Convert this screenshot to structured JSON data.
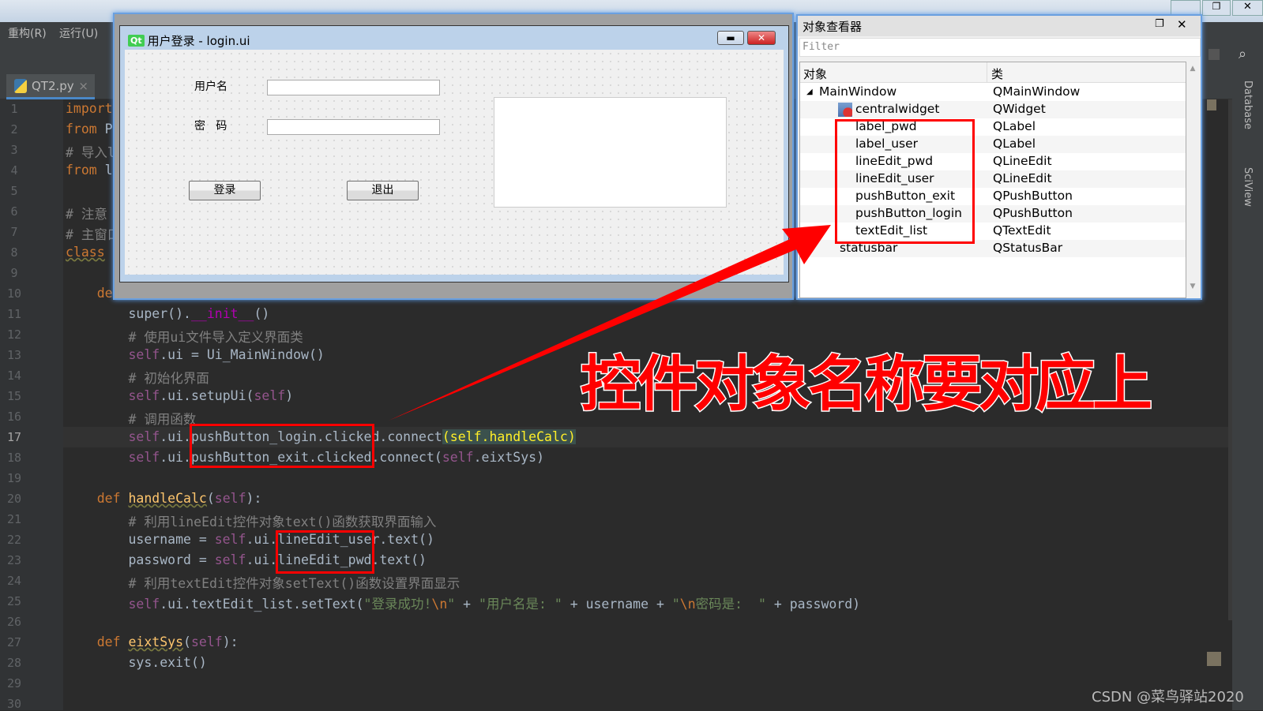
{
  "ide": {
    "menu": [
      "重构(R)",
      "运行(U)"
    ],
    "tab": {
      "label": "QT2.py",
      "close": "×"
    },
    "current_line": 17,
    "lines": [
      {
        "n": 1,
        "t": [
          [
            "import",
            "kw"
          ]
        ]
      },
      {
        "n": 2,
        "t": [
          [
            "from",
            "kw"
          ],
          [
            " P",
            ""
          ]
        ]
      },
      {
        "n": 3,
        "t": [
          [
            "# 导入l",
            "cm"
          ]
        ]
      },
      {
        "n": 4,
        "t": [
          [
            "from",
            "kw"
          ],
          [
            " l",
            ""
          ]
        ]
      },
      {
        "n": 5,
        "t": []
      },
      {
        "n": 6,
        "t": [
          [
            "# 注意",
            "cm"
          ]
        ]
      },
      {
        "n": 7,
        "t": [
          [
            "# 主窗口",
            "cm"
          ]
        ]
      },
      {
        "n": 8,
        "t": [
          [
            "class",
            "kw wavy"
          ]
        ]
      },
      {
        "n": 9,
        "t": []
      },
      {
        "n": 10,
        "t": [
          [
            "    de",
            "kw"
          ]
        ]
      },
      {
        "n": 11,
        "t": [
          [
            "        super().",
            ""
          ],
          [
            "__init__",
            "dun"
          ],
          [
            "()",
            ""
          ]
        ]
      },
      {
        "n": 12,
        "t": [
          [
            "        # 使用ui文件导入定义界面类",
            "cm"
          ]
        ]
      },
      {
        "n": 13,
        "t": [
          [
            "        ",
            ""
          ],
          [
            "self",
            "self"
          ],
          [
            ".ui = Ui_MainWindow()",
            ""
          ]
        ]
      },
      {
        "n": 14,
        "t": [
          [
            "        # 初始化界面",
            "cm"
          ]
        ]
      },
      {
        "n": 15,
        "t": [
          [
            "        ",
            ""
          ],
          [
            "self",
            "self"
          ],
          [
            ".ui.setupUi(",
            ""
          ],
          [
            "self",
            "self"
          ],
          [
            ")",
            ""
          ]
        ]
      },
      {
        "n": 16,
        "t": [
          [
            "        # 调用函数",
            "cm"
          ]
        ]
      },
      {
        "n": 17,
        "t": [
          [
            "        ",
            ""
          ],
          [
            "self",
            "self"
          ],
          [
            ".ui.pushButton_login.clicked.connect",
            ""
          ],
          [
            "(",
            "br"
          ],
          [
            "self",
            "self br"
          ],
          [
            ".handleCalc",
            "br"
          ],
          [
            ")",
            "br"
          ]
        ]
      },
      {
        "n": 18,
        "t": [
          [
            "        ",
            ""
          ],
          [
            "self",
            "self"
          ],
          [
            ".ui.pushButton_exit.clicked.connect(",
            ""
          ],
          [
            "self",
            "self"
          ],
          [
            ".eixtSys)",
            ""
          ]
        ]
      },
      {
        "n": 19,
        "t": []
      },
      {
        "n": 20,
        "t": [
          [
            "    ",
            ""
          ],
          [
            "def",
            "kw"
          ],
          [
            " ",
            ""
          ],
          [
            "handleCalc",
            "fn wavy"
          ],
          [
            "(",
            ""
          ],
          [
            "self",
            "self"
          ],
          [
            "):",
            ""
          ]
        ]
      },
      {
        "n": 21,
        "t": [
          [
            "        # 利用lineEdit控件对象text()函数获取界面输入",
            "cm"
          ]
        ]
      },
      {
        "n": 22,
        "t": [
          [
            "        username = ",
            ""
          ],
          [
            "self",
            "self"
          ],
          [
            ".ui.lineEdit_user.text()",
            ""
          ]
        ]
      },
      {
        "n": 23,
        "t": [
          [
            "        password = ",
            ""
          ],
          [
            "self",
            "self"
          ],
          [
            ".ui.lineEdit_pwd.text()",
            ""
          ]
        ]
      },
      {
        "n": 24,
        "t": [
          [
            "        # 利用textEdit控件对象setText()函数设置界面显示",
            "cm"
          ]
        ]
      },
      {
        "n": 25,
        "t": [
          [
            "        ",
            ""
          ],
          [
            "self",
            "self"
          ],
          [
            ".ui.textEdit_list.setText(",
            ""
          ],
          [
            "\"登录成功!",
            "str"
          ],
          [
            "\\n",
            "esc"
          ],
          [
            "\"",
            "str"
          ],
          [
            " + ",
            ""
          ],
          [
            "\"用户名是: \"",
            "str"
          ],
          [
            " + username + ",
            ""
          ],
          [
            "\"",
            "str"
          ],
          [
            "\\n",
            "esc"
          ],
          [
            "密码是:  \"",
            "str"
          ],
          [
            " + password)",
            ""
          ]
        ]
      },
      {
        "n": 26,
        "t": []
      },
      {
        "n": 27,
        "t": [
          [
            "    ",
            ""
          ],
          [
            "def",
            "kw"
          ],
          [
            " ",
            ""
          ],
          [
            "eixtSys",
            "fn wavy"
          ],
          [
            "(",
            ""
          ],
          [
            "self",
            "self"
          ],
          [
            "):",
            ""
          ]
        ]
      },
      {
        "n": 28,
        "t": [
          [
            "        sys.exit()",
            ""
          ]
        ]
      },
      {
        "n": 29,
        "t": []
      },
      {
        "n": 30,
        "t": []
      }
    ],
    "right_tools": [
      "Database",
      "SciView"
    ]
  },
  "designer": {
    "title": "用户登录 - login.ui",
    "qt_badge": "Qt",
    "min_icon": "▬",
    "close_icon": "✕",
    "label_user": "用户名",
    "label_pwd": "密   码",
    "btn_login": "登录",
    "btn_exit": "退出"
  },
  "inspector": {
    "title": "对象查看器",
    "filter_placeholder": "Filter",
    "col_object": "对象",
    "col_class": "类",
    "rows": [
      {
        "obj": "MainWindow",
        "cls": "QMainWindow",
        "level": 0,
        "expand": true
      },
      {
        "obj": "centralwidget",
        "cls": "QWidget",
        "level": 1,
        "expand": true,
        "icon": true
      },
      {
        "obj": "label_pwd",
        "cls": "QLabel",
        "level": 2
      },
      {
        "obj": "label_user",
        "cls": "QLabel",
        "level": 2
      },
      {
        "obj": "lineEdit_pwd",
        "cls": "QLineEdit",
        "level": 2
      },
      {
        "obj": "lineEdit_user",
        "cls": "QLineEdit",
        "level": 2
      },
      {
        "obj": "pushButton_exit",
        "cls": "QPushButton",
        "level": 2
      },
      {
        "obj": "pushButton_login",
        "cls": "QPushButton",
        "level": 2
      },
      {
        "obj": "textEdit_list",
        "cls": "QTextEdit",
        "level": 2
      },
      {
        "obj": "statusbar",
        "cls": "QStatusBar",
        "level": 1
      }
    ]
  },
  "annotation": {
    "text": "控件对象名称要对应上",
    "color": "#ff0000"
  },
  "watermark": "CSDN @菜鸟驿站2020",
  "colors": {
    "editor_bg": "#2b2b2b",
    "keyword": "#cc7832",
    "self": "#94558d",
    "comment": "#808080",
    "string": "#6a8759",
    "highlight": "#ff0000"
  }
}
